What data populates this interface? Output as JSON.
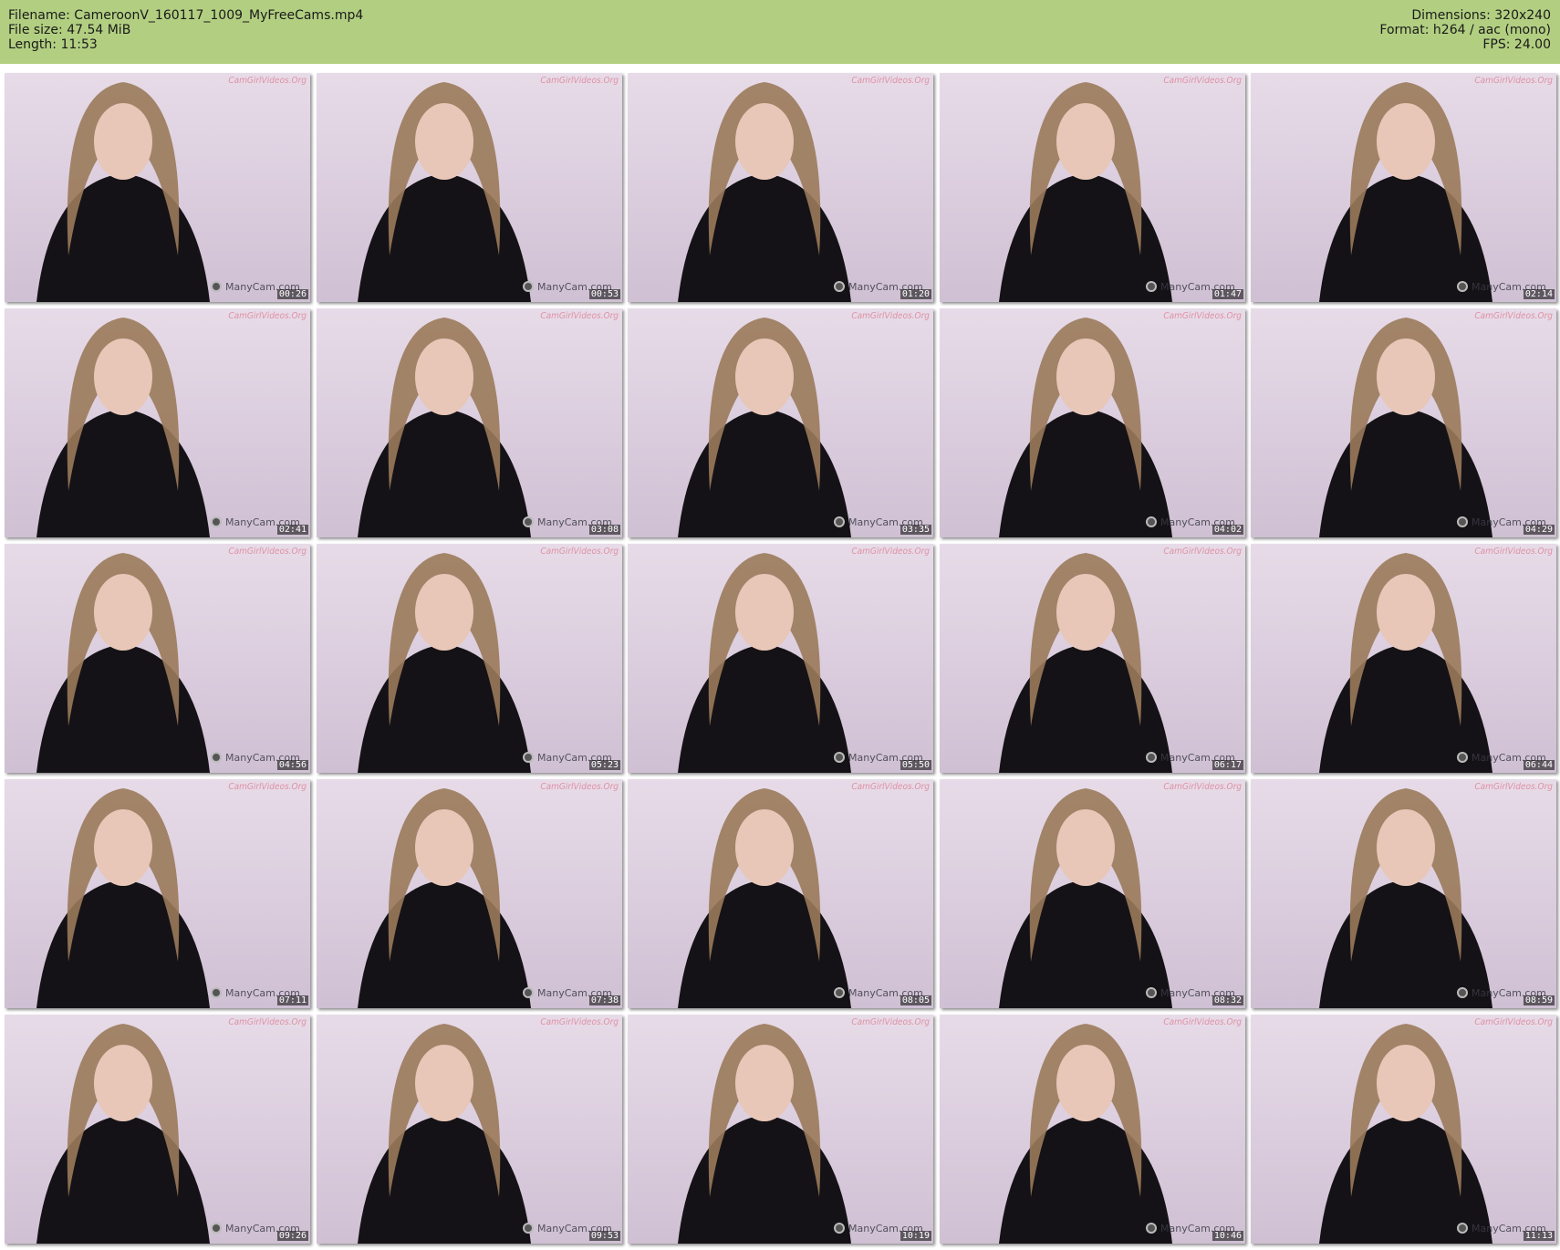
{
  "header": {
    "filename": "Filename: CameroonV_160117_1009_MyFreeCams.mp4",
    "file_size": "File size: 47.54 MiB",
    "length": "Length: 11:53",
    "dimensions": "Dimensions: 320x240",
    "format": "Format: h264 / aac (mono)",
    "fps": "FPS: 24.00"
  },
  "watermarks": {
    "top": "CamGirlVideos.Org",
    "bottom": "ManyCam.com"
  },
  "thumbnails": [
    {
      "time": "00:26"
    },
    {
      "time": "00:53"
    },
    {
      "time": "01:20"
    },
    {
      "time": "01:47"
    },
    {
      "time": "02:14"
    },
    {
      "time": "02:41"
    },
    {
      "time": "03:08"
    },
    {
      "time": "03:35"
    },
    {
      "time": "04:02"
    },
    {
      "time": "04:29"
    },
    {
      "time": "04:56"
    },
    {
      "time": "05:23"
    },
    {
      "time": "05:50"
    },
    {
      "time": "06:17"
    },
    {
      "time": "06:44"
    },
    {
      "time": "07:11"
    },
    {
      "time": "07:38"
    },
    {
      "time": "08:05"
    },
    {
      "time": "08:32"
    },
    {
      "time": "08:59"
    },
    {
      "time": "09:26"
    },
    {
      "time": "09:53"
    },
    {
      "time": "10:19"
    },
    {
      "time": "10:46"
    },
    {
      "time": "11:13"
    }
  ],
  "colors": {
    "header_bg": "#b2cf81",
    "background": "#ffffff"
  }
}
